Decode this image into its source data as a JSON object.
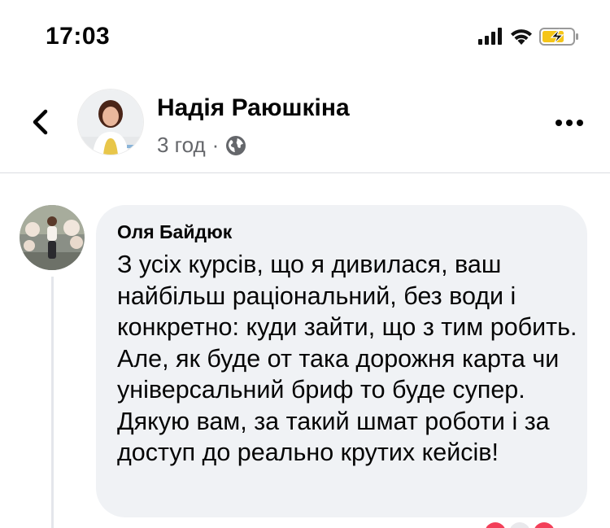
{
  "status_bar": {
    "time": "17:03",
    "icons": [
      "cellular-signal-icon",
      "wifi-icon",
      "battery-charging-icon"
    ],
    "battery_color": "#f5c518"
  },
  "post": {
    "author_name": "Надія Раюшкіна",
    "time_ago": "3 год",
    "separator": "·",
    "privacy_icon": "globe-icon"
  },
  "comment": {
    "author_name": "Оля Байдюк",
    "text": "З усіх курсів, що я дивилася, ваш найбільш раціональний, без води і конкретно: куди зайти, що з тим робить. Але, як буде от така дорожня карта чи універсальний бриф то буде супер. Дякую вам, за такий шмат роботи і за доступ до реально крутих кейсів!"
  },
  "colors": {
    "bubble": "#f0f2f5",
    "secondary_text": "#65676b",
    "divider": "#dadde1"
  }
}
